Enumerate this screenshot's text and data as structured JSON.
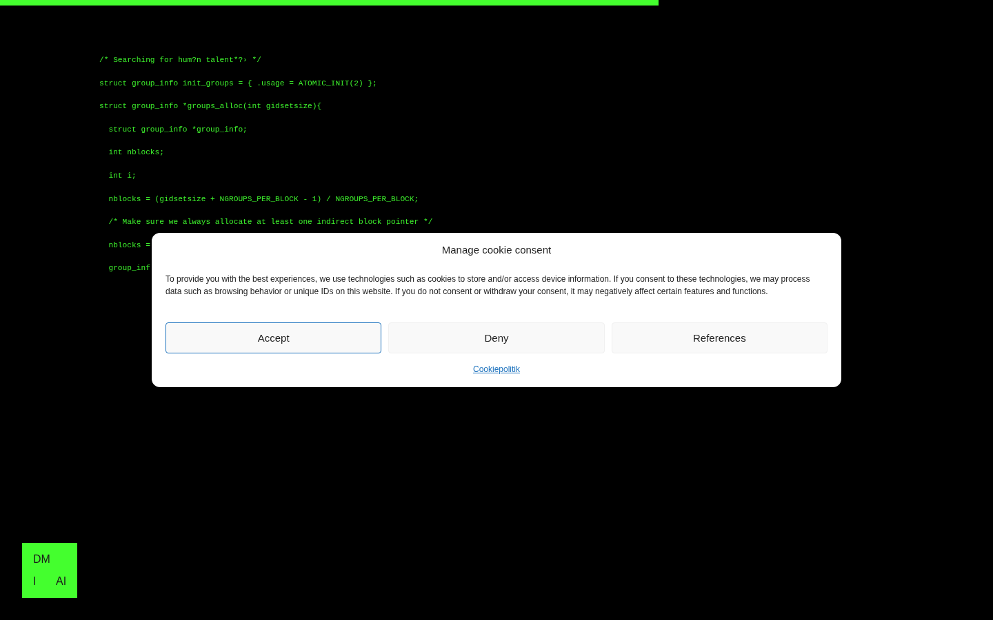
{
  "progress": {
    "level": 0.663
  },
  "code": {
    "lines": [
      {
        "text": "/* Searching for hum?n talent*?› */"
      },
      {
        "text": "struct group_info init_groups = { .usage = ATOMIC_INIT(2) };"
      },
      {
        "text": "struct group_info *groups_alloc(int gidsetsize){",
        "children": [
          {
            "text": "struct group_info *group_info;"
          },
          {
            "text": "int nblocks;"
          },
          {
            "text": "int i;"
          },
          {
            "text": "nblocks = (gidsetsize + NGROUPS_PER_BLOCK - 1) / NGROUPS_PER_BLOCK;"
          },
          {
            "text": "/* Make sure we always allocate at least one indirect block pointer */"
          },
          {
            "text": "nblocks ="
          },
          {
            "text": "group_inf"
          }
        ]
      }
    ]
  },
  "cookie_dialog": {
    "title": "Manage cookie consent",
    "message": "To provide you with the best experiences, we use technologies such as cookies to store and/or access device information. If you consent to these technologies, we may process data such as browsing behavior or unique IDs on this website. If you do not consent or withdraw your consent, it may negatively affect certain features and functions.",
    "buttons": [
      {
        "label": "Accept",
        "focused": true
      },
      {
        "label": "Deny",
        "focused": false
      },
      {
        "label": "References",
        "focused": false
      }
    ],
    "link": "Cookiepolitik"
  },
  "logo": {
    "rows": [
      [
        "DM"
      ],
      [
        "I",
        "AI"
      ]
    ]
  }
}
